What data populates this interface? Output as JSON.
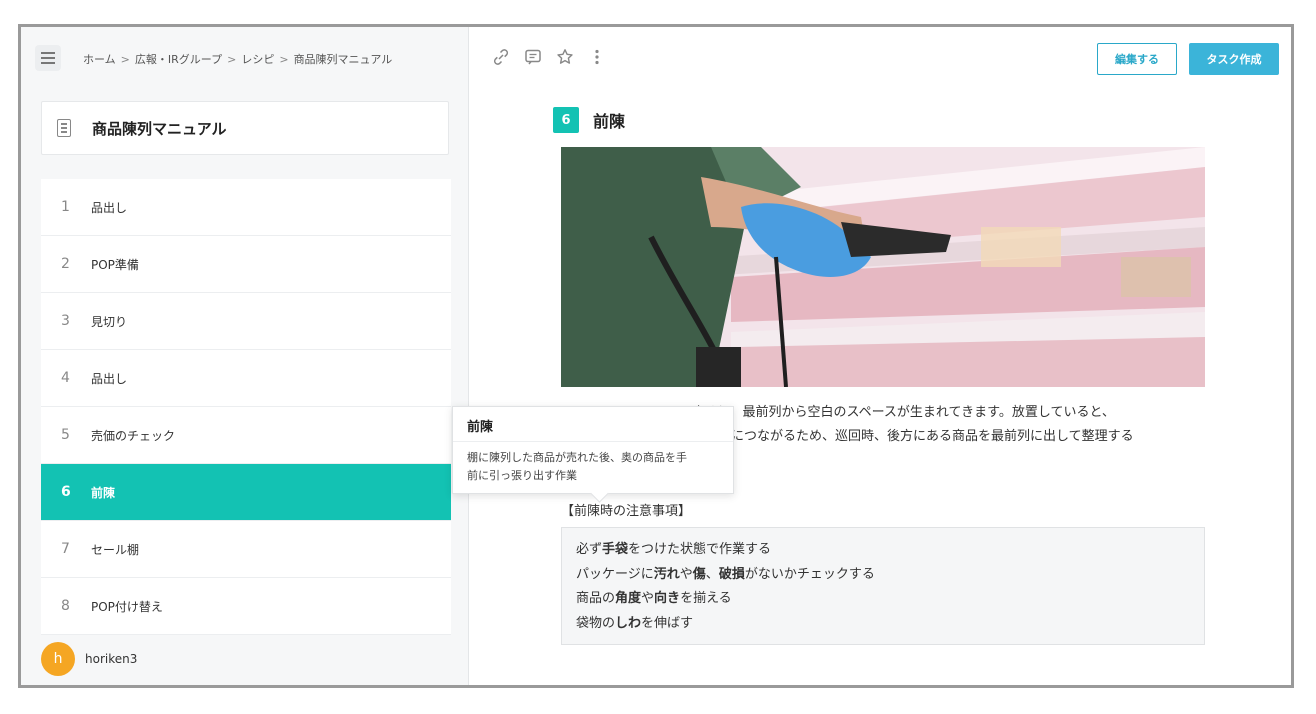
{
  "breadcrumb": [
    "ホーム",
    "広報・IRグループ",
    "レシピ",
    "商品陳列マニュアル"
  ],
  "breadcrumb_sep": ">",
  "sidebar": {
    "title": "商品陳列マニュアル",
    "steps": [
      {
        "num": "1",
        "label": "品出し"
      },
      {
        "num": "2",
        "label": "POP準備"
      },
      {
        "num": "3",
        "label": "見切り"
      },
      {
        "num": "4",
        "label": "品出し"
      },
      {
        "num": "5",
        "label": "売価のチェック"
      },
      {
        "num": "6",
        "label": "前陳"
      },
      {
        "num": "7",
        "label": "セール棚"
      },
      {
        "num": "8",
        "label": "POP付け替え"
      }
    ],
    "active_step": "6"
  },
  "user": {
    "initial": "h",
    "name": "horiken3",
    "avatar_color": "#f5a623"
  },
  "toolbar": {
    "icons": [
      "link-icon",
      "comment-icon",
      "star-icon",
      "more-vertical-icon"
    ],
    "edit_label": "編集する",
    "task_label": "タスク作成"
  },
  "step": {
    "number": "6",
    "title": "前陳",
    "body_line1": "すると、最前列から空白のスペースが生まれてきます。放置していると、",
    "body_line2": "につながるため、巡回時、後方にある商品を最前列に出して整理する",
    "notes_heading": "【前陳時の注意事項】"
  },
  "notes": [
    [
      {
        "t": "必ず"
      },
      {
        "t": "手袋",
        "b": true
      },
      {
        "t": "をつけた状態で作業する"
      }
    ],
    [
      {
        "t": "パッケージに"
      },
      {
        "t": "汚れ",
        "b": true
      },
      {
        "t": "や"
      },
      {
        "t": "傷",
        "b": true
      },
      {
        "t": "、"
      },
      {
        "t": "破損",
        "b": true
      },
      {
        "t": "がないかチェックする"
      }
    ],
    [
      {
        "t": "商品の"
      },
      {
        "t": "角度",
        "b": true
      },
      {
        "t": "や"
      },
      {
        "t": "向き",
        "b": true
      },
      {
        "t": "を揃える"
      }
    ],
    [
      {
        "t": "袋物の"
      },
      {
        "t": "しわ",
        "b": true
      },
      {
        "t": "を伸ばす"
      }
    ]
  ],
  "tooltip": {
    "title": "前陳",
    "body_line1": "棚に陳列した商品が売れた後、奥の商品を手",
    "body_line2": "前に引っ張り出す作業"
  },
  "colors": {
    "accent": "#13c2b3",
    "button": "#3bb4d9"
  }
}
